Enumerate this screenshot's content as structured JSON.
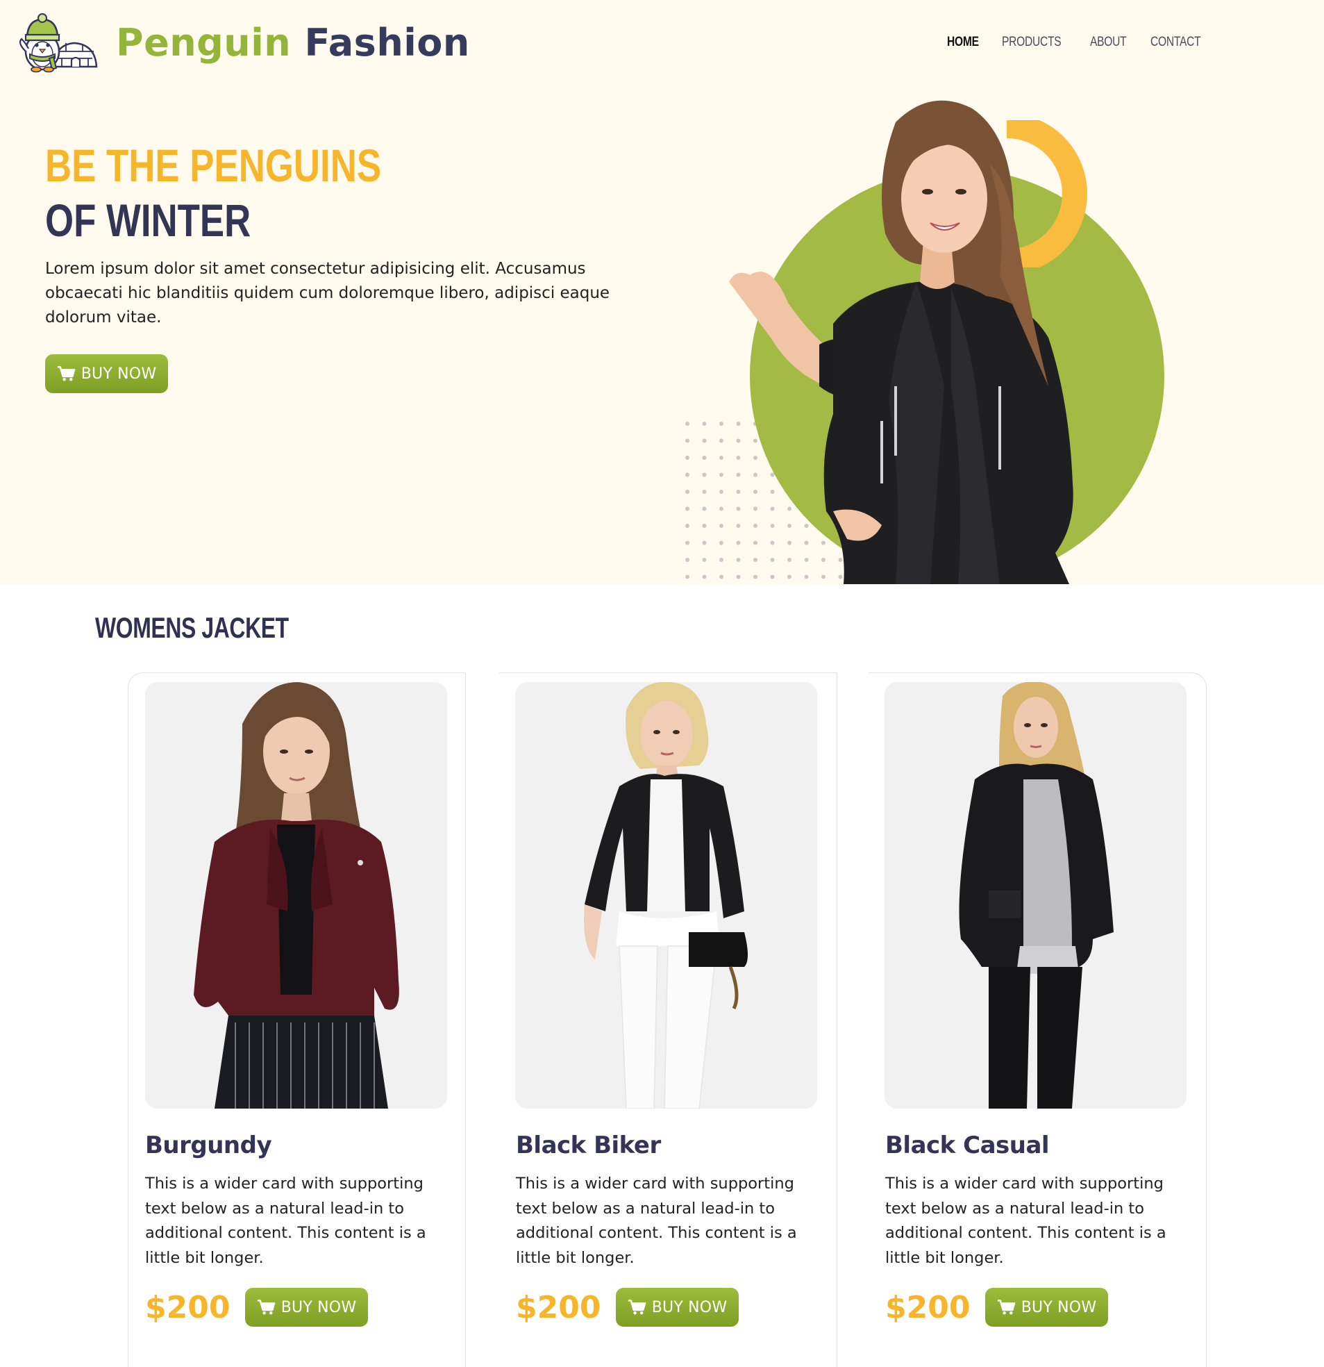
{
  "brand": {
    "name_part1": "Penguin",
    "name_part2": "Fashion"
  },
  "nav": {
    "items": [
      {
        "label": "HOME",
        "active": true
      },
      {
        "label": "PRODUCTS",
        "active": false
      },
      {
        "label": "ABOUT",
        "active": false
      },
      {
        "label": "CONTACT",
        "active": false
      }
    ]
  },
  "hero": {
    "headline_line1": "BE THE PENGUINS",
    "headline_line2": "OF WINTER",
    "paragraph": "Lorem ipsum dolor sit amet consectetur adipisicing elit. Accusamus obcaecati hic blanditiis quidem cum doloremque libero, adipisci eaque dolorum vitae.",
    "button_label": "BUY NOW",
    "button_icon": "cart-icon"
  },
  "products": {
    "section_title": "WOMENS JACKET",
    "items": [
      {
        "title": "Burgundy",
        "text": "This is a wider card with supporting text below as a natural lead-in to additional content. This content is a little bit longer.",
        "price": "$200",
        "button_label": "BUY NOW"
      },
      {
        "title": "Black Biker",
        "text": "This is a wider card with supporting text below as a natural lead-in to additional content. This content is a little bit longer.",
        "price": "$200",
        "button_label": "BUY NOW"
      },
      {
        "title": "Black Casual",
        "text": "This is a wider card with supporting text below as a natural lead-in to additional content. This content is a little bit longer.",
        "price": "$200",
        "button_label": "BUY NOW"
      }
    ]
  },
  "colors": {
    "hero_bg": "#fffaee",
    "brand_green": "#95b53a",
    "brand_navy": "#363a5c",
    "accent_yellow": "#f7b52a",
    "button_green": "#8aab2e",
    "circle_green": "#a3bb44"
  }
}
